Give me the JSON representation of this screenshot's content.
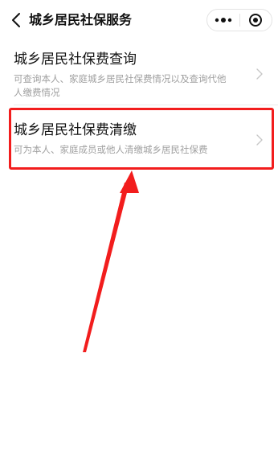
{
  "nav": {
    "title": "城乡居民社保服务",
    "back_icon": "chevron-left-icon",
    "more_icon": "more-dots-icon",
    "close_icon": "target-circle-icon"
  },
  "items": [
    {
      "title": "城乡居民社保费查询",
      "desc_line1": "可查询本人、家庭城乡居民社保费情况以及查询代他",
      "desc_line2": "人缴费情况",
      "icon": "chevron-right-icon"
    },
    {
      "title": "城乡居民社保费清缴",
      "desc_line1": "可为本人、家庭成员或他人清缴城乡居民社保费",
      "icon": "chevron-right-icon"
    }
  ],
  "annotation": {
    "highlight_color": "#f21d1d",
    "arrow_color": "#f21d1d",
    "highlighted_item": "城乡居民社保费清缴"
  }
}
